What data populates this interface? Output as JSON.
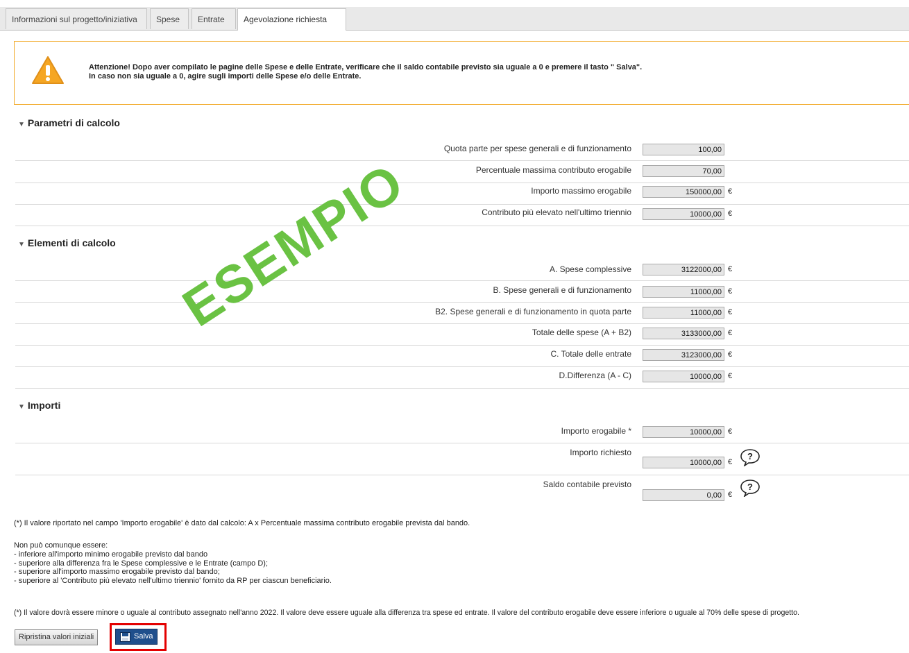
{
  "tabs": [
    {
      "label": "Informazioni sul progetto/iniziativa"
    },
    {
      "label": "Spese"
    },
    {
      "label": "Entrate"
    },
    {
      "label": "Agevolazione richiesta"
    }
  ],
  "warning": {
    "line1": "Attenzione! Dopo aver compilato le pagine delle Spese e delle Entrate, verificare che il saldo contabile previsto sia uguale a 0 e premere il tasto \" Salva\".",
    "line2": "In caso non sia uguale a 0, agire sugli importi delle Spese e/o delle Entrate."
  },
  "sections": {
    "parametri": {
      "title": "Parametri di calcolo",
      "rows": [
        {
          "label": "Quota parte per spese generali e di funzionamento",
          "value": "100,00",
          "unit": ""
        },
        {
          "label": "Percentuale massima contributo erogabile",
          "value": "70,00",
          "unit": ""
        },
        {
          "label": "Importo massimo erogabile",
          "value": "150000,00",
          "unit": "€"
        },
        {
          "label": "Contributo più elevato nell'ultimo triennio",
          "value": "10000,00",
          "unit": "€"
        }
      ]
    },
    "elementi": {
      "title": "Elementi di calcolo",
      "rows": [
        {
          "label": "A. Spese complessive",
          "value": "3122000,00",
          "unit": "€"
        },
        {
          "label": "B. Spese generali e di funzionamento",
          "value": "11000,00",
          "unit": "€"
        },
        {
          "label": "B2. Spese generali e di funzionamento in quota parte",
          "value": "11000,00",
          "unit": "€"
        },
        {
          "label": "Totale delle spese (A + B2)",
          "value": "3133000,00",
          "unit": "€"
        },
        {
          "label": "C. Totale delle entrate",
          "value": "3123000,00",
          "unit": "€"
        },
        {
          "label": "D.Differenza (A - C)",
          "value": "10000,00",
          "unit": "€"
        }
      ]
    },
    "importi": {
      "title": "Importi",
      "rows": [
        {
          "label": "Importo erogabile *",
          "value": "10000,00",
          "unit": "€"
        },
        {
          "label": "Importo richiesto",
          "value": "10000,00",
          "unit": "€"
        },
        {
          "label": "Saldo contabile previsto",
          "value": "0,00",
          "unit": "€"
        }
      ]
    }
  },
  "notes": {
    "n1": "(*) Il valore riportato nel campo 'Importo erogabile' è dato dal calcolo: A x Percentuale massima contributo erogabile prevista dal bando.",
    "lines": [
      "Non può comunque essere:",
      "- inferiore all'importo minimo erogabile previsto dal bando",
      "- superiore alla differenza fra le Spese complessive e le Entrate (campo D);",
      "- superiore all'importo massimo erogabile previsto dal bando;",
      "- superiore al 'Contributo più elevato nell'ultimo triennio' fornito da RP per ciascun beneficiario."
    ],
    "n2": "(*) Il valore dovrà essere minore o uguale al contributo assegnato nell'anno 2022. Il valore deve essere uguale alla differenza tra spese ed entrate. Il valore del contributo erogabile deve essere inferiore o uguale al 70% delle spese di progetto."
  },
  "buttons": {
    "reset": "Ripristina valori iniziali",
    "save": "Salva"
  },
  "watermark": "ESEMPIO",
  "colors": {
    "warning_border": "#f2ab2b",
    "save_button": "#1f4f8c",
    "highlight": "#e30000",
    "watermark": "#6ac243"
  }
}
